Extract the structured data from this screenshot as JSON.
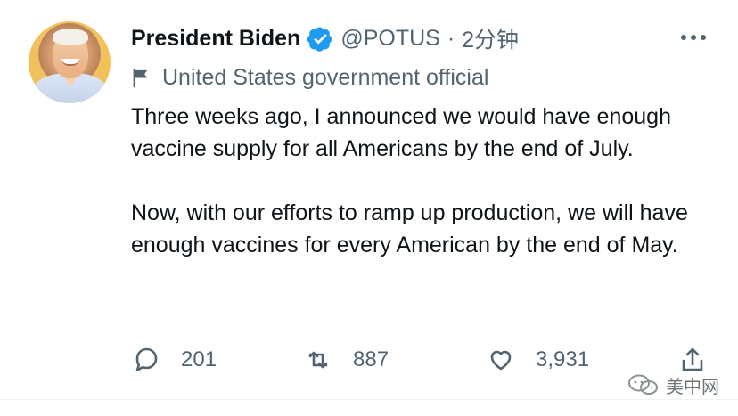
{
  "tweet": {
    "display_name": "President Biden",
    "handle": "@POTUS",
    "separator": "·",
    "time": "2分钟",
    "label": "United States government official",
    "body": [
      "Three weeks ago, I announced we would have enough vaccine supply for all Americans by the end of July.",
      "Now, with our efforts to ramp up production, we will have enough vaccines for every American by the end of May."
    ],
    "counts": {
      "replies": "201",
      "retweets": "887",
      "likes": "3,931"
    }
  },
  "watermark": {
    "text": "美中网"
  },
  "colors": {
    "primary_text": "#0f1419",
    "secondary_text": "#536471",
    "verified": "#1d9bf0"
  },
  "icons": {
    "verified": "verified-badge-icon",
    "label": "flag-icon",
    "reply": "reply-icon",
    "retweet": "retweet-icon",
    "like": "heart-icon",
    "share": "share-icon",
    "more": "more-icon"
  }
}
